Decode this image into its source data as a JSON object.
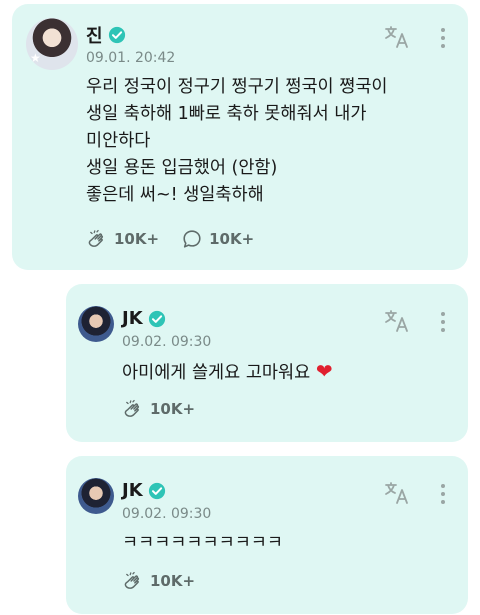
{
  "posts": [
    {
      "author": "진",
      "timestamp": "09.01. 20:42",
      "lines": [
        "우리 정국이 정구기 쩡구기 쩡국이 쪙국이",
        "생일 축하해 1빠로 축하 못해줘서 내가",
        "미안하다",
        "생일 용돈 입금했어 (안함)",
        "좋은데 써~! 생일축하해"
      ],
      "likes": "10K+",
      "comments": "10K+",
      "avatar_icon": "avatar-jin",
      "badge_icon": "verified-badge-icon"
    },
    {
      "author": "JK",
      "timestamp": "09.02. 09:30",
      "text": "아미에게 쓸게요 고마워요",
      "emoji": "❤",
      "likes": "10K+",
      "avatar_icon": "avatar-jk",
      "badge_icon": "verified-badge-icon"
    },
    {
      "author": "JK",
      "timestamp": "09.02. 09:30",
      "text": "ㅋㅋㅋㅋㅋㅋㅋㅋㅋㅋ",
      "likes": "10K+",
      "avatar_icon": "avatar-jk",
      "badge_icon": "verified-badge-icon"
    }
  ],
  "colors": {
    "card_bg": "#dff7f3",
    "verified": "#2ec4b6",
    "heart": "#e0202f",
    "muted": "#7a8a88"
  }
}
